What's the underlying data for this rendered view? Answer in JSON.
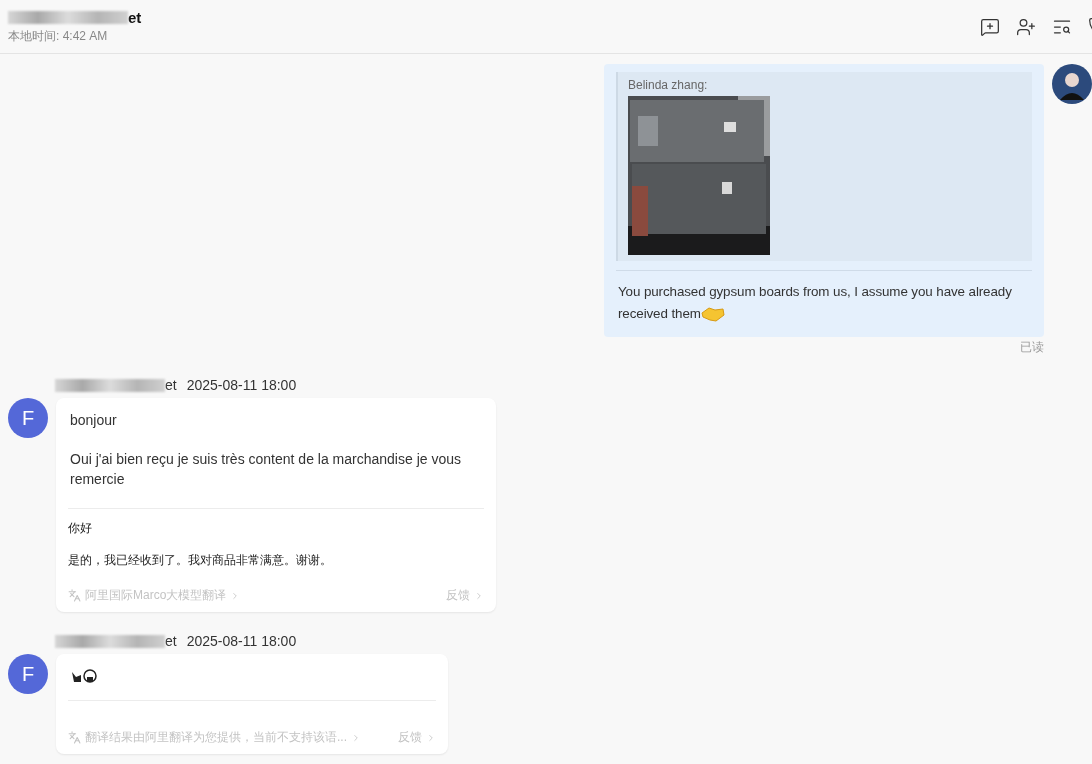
{
  "header": {
    "title_visible": "et",
    "local_time": "本地时间: 4:42 AM"
  },
  "outgoing": {
    "quote": {
      "author": "Belinda zhang:",
      "kind": "picture"
    },
    "text": "You purchased gypsum boards from us, I assume you have already received them",
    "read_status": "已读"
  },
  "incoming": [
    {
      "sender_visible": "et",
      "time": "2025-08-11 18:00",
      "avatar_letter": "F",
      "paragraphs": [
        "bonjour",
        "Oui j'ai bien reçu je suis très content de la marchandise je vous remercie"
      ],
      "translation": [
        "你好",
        "是的，我已经收到了。我对商品非常满意。谢谢。"
      ],
      "footer": "阿里国际Marco大模型翻译",
      "feedback": "反馈",
      "kind": "text"
    },
    {
      "sender_visible": "et",
      "time": "2025-08-11 18:00",
      "avatar_letter": "F",
      "footer": "翻译结果由阿里翻译为您提供，当前不支持该语...",
      "feedback": "反馈",
      "kind": "emoji"
    }
  ]
}
